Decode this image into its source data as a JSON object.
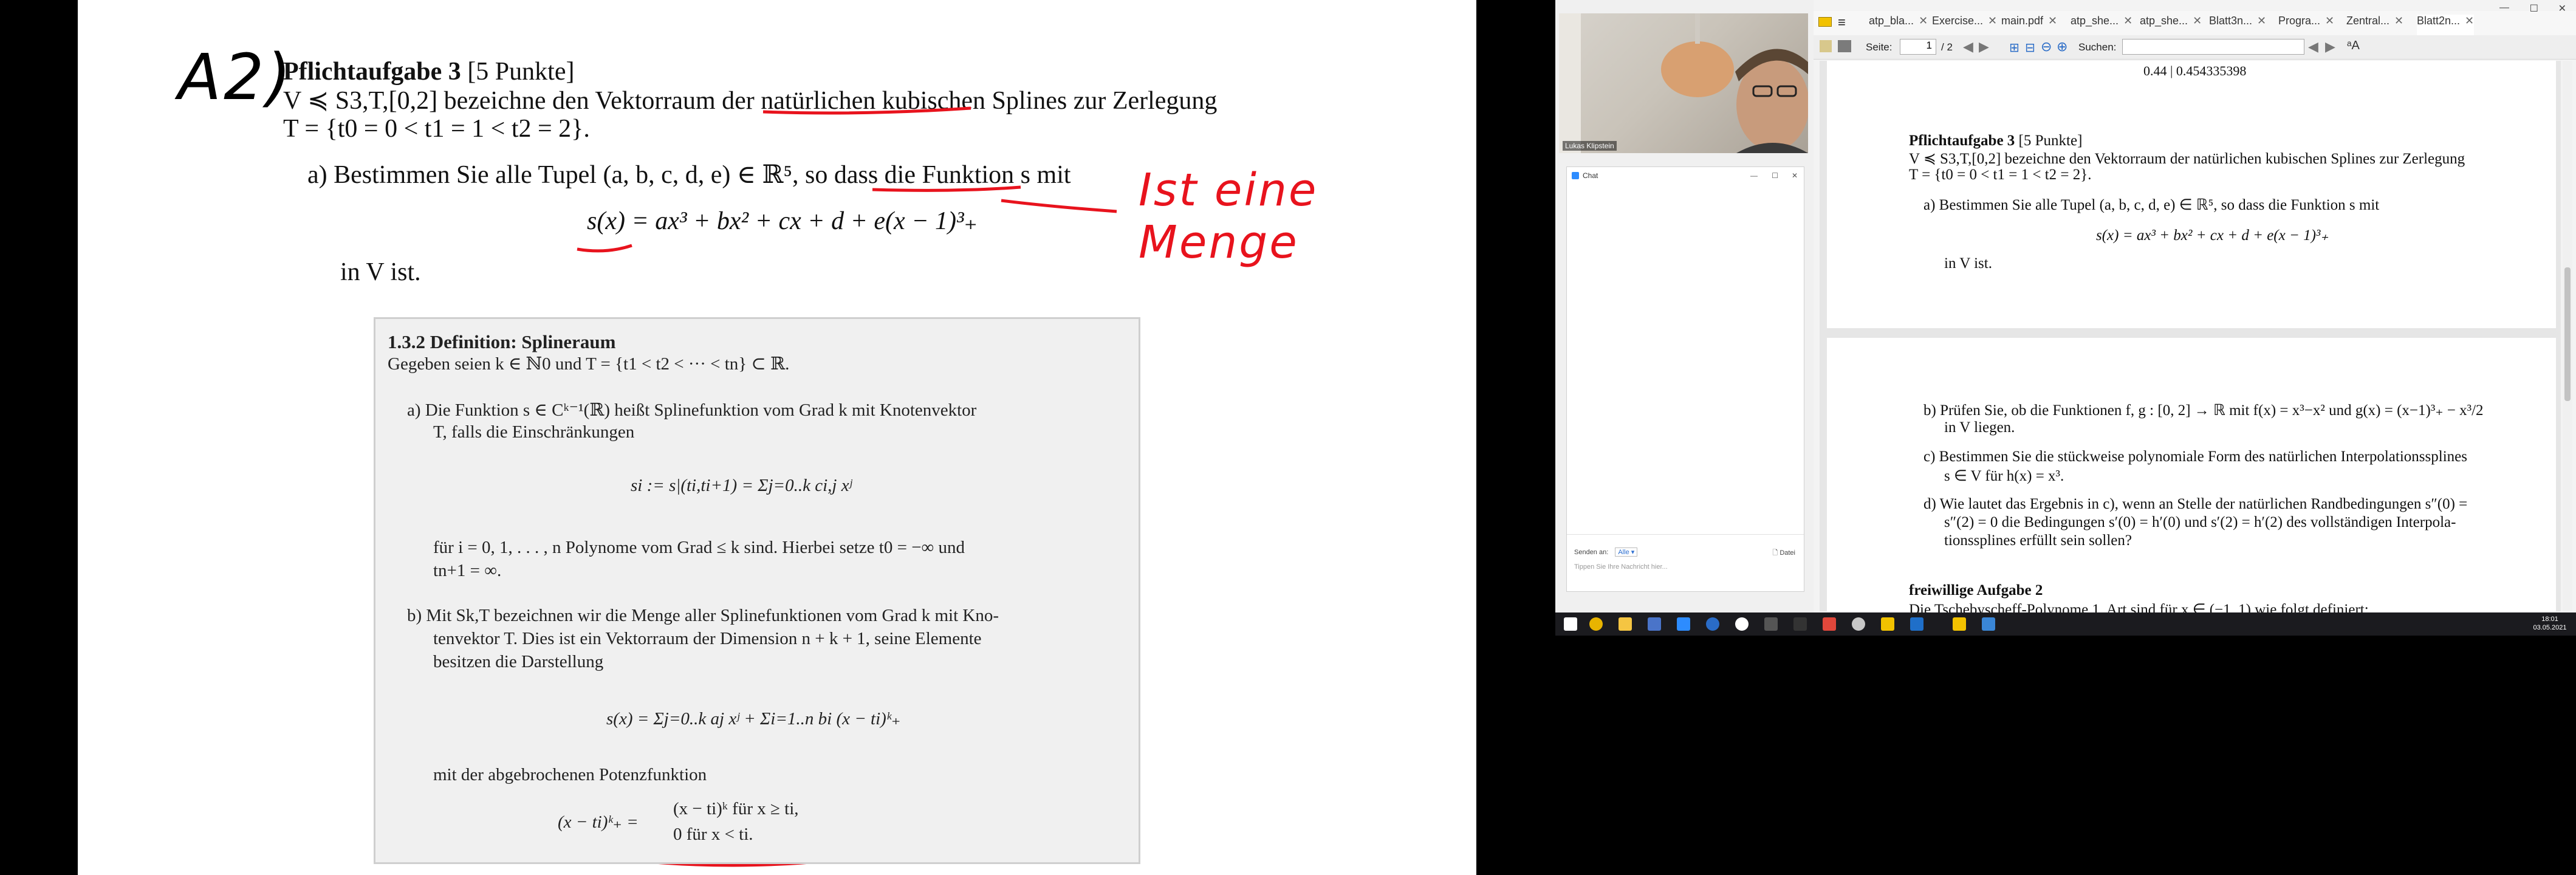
{
  "board": {
    "handwritten_label": "A2)",
    "annotation": "Ist eine Menge",
    "task_title": "Pflichtaufgabe 3",
    "task_points": "[5 Punkte]",
    "line1": "V ≼ S3,T,[0,2] bezeichne den Vektorraum der natürlichen kubischen Splines zur Zerlegung",
    "line2": "T = {t0 = 0 < t1 = 1 < t2 = 2}.",
    "part_a": "a)  Bestimmen Sie alle Tupel (a, b, c, d, e) ∈ ℝ⁵, so dass die Funktion s mit",
    "formula": "s(x) = ax³ + bx² + cx + d + e(x − 1)³₊",
    "in_v": "in V ist.",
    "def": {
      "title": "1.3.2   Definition: Splineraum",
      "intro": "Gegeben seien k ∈ ℕ0 und T = {t1 < t2 < ··· < tn} ⊂ ℝ.",
      "a1": "a)  Die Funktion s ∈ Cᵏ⁻¹(ℝ) heißt Splinefunktion vom Grad k mit Knotenvektor",
      "a2": "T, falls die Einschränkungen",
      "a_formula": "si := s|(ti,ti+1) = Σj=0..k ci,j xʲ",
      "a3": "für i = 0, 1, . . . , n Polynome vom Grad ≤ k sind. Hierbei setze t0 = −∞ und",
      "a4": "tn+1 = ∞.",
      "b1": "b)  Mit Sk,T bezeichnen wir die Menge aller Splinefunktionen vom Grad k mit Kno-",
      "b2": "tenvektor T. Dies ist ein Vektorraum der Dimension n + k + 1, seine Elemente",
      "b3": "besitzen die Darstellung",
      "b_formula": "s(x) = Σj=0..k aj xʲ + Σi=1..n bi (x − ti)ᵏ₊",
      "b4": "mit der abgebrochenen Potenzfunktion",
      "trunc_lhs": "(x − ti)ᵏ₊ =",
      "trunc_case1": "(x − ti)ᵏ    für  x ≥ ti,",
      "trunc_case2": "0             für  x < ti."
    }
  },
  "video": {
    "name_label": "Lukas Klipstein"
  },
  "chat": {
    "title": "Chat",
    "send_to_label": "Senden an:",
    "send_to_value": "Alle",
    "file_button": "Datei",
    "input_placeholder": "Tippen Sie Ihre Nachricht hier..."
  },
  "pdf_viewer": {
    "tabs": [
      "atp_bla...",
      "Exercise...",
      "main.pdf",
      "atp_she...",
      "atp_she...",
      "Blatt3n...",
      "Progra...",
      "Zentral...",
      "Blatt2n..."
    ],
    "page_label": "Seite:",
    "page_value": "1",
    "page_total": "/ 2",
    "search_label": "Suchen:",
    "top_value": "0.44 | 0.454335398",
    "p1_title": "Pflichtaufgabe 3",
    "p1_points": "[5 Punkte]",
    "p1_line1": "V ≼ S3,T,[0,2] bezeichne den Vektorraum der natürlichen kubischen Splines zur Zerlegung",
    "p1_line2": "T = {t0 = 0 < t1 = 1 < t2 = 2}.",
    "p1_a": "a)  Bestimmen Sie alle Tupel (a, b, c, d, e) ∈ ℝ⁵, so dass die Funktion s mit",
    "p1_formula": "s(x) = ax³ + bx² + cx + d + e(x − 1)³₊",
    "p1_in_v": "in V ist.",
    "p2_b1": "b)  Prüfen Sie, ob die Funktionen f, g : [0, 2] → ℝ mit f(x) = x³−x² und g(x) = (x−1)³₊ − x³/2",
    "p2_b2": "in V liegen.",
    "p2_c1": "c)  Bestimmen Sie die stückweise polynomiale Form des natürlichen Interpolationssplines",
    "p2_c2": "s ∈ V für h(x) = x³.",
    "p2_d1": "d)  Wie lautet das Ergebnis in c), wenn an Stelle der natürlichen Randbedingungen s″(0) =",
    "p2_d2": "s″(2) = 0 die Bedingungen s′(0) = h′(0) und s′(2) = h′(2) des vollständigen Interpola-",
    "p2_d3": "tionssplines erfüllt sein sollen?",
    "p2_next_title": "freiwillige Aufgabe 2",
    "p2_next_line": "Die Tschebyscheff-Polynome 1. Art sind für x ∈ (−1, 1) wie folgt definiert:"
  },
  "taskbar": {
    "time": "18:01",
    "date": "03.05.2021"
  },
  "colors": {
    "ink_red": "#e8131d",
    "ink_black": "#000000",
    "taskbar": "#1b1b1f"
  }
}
